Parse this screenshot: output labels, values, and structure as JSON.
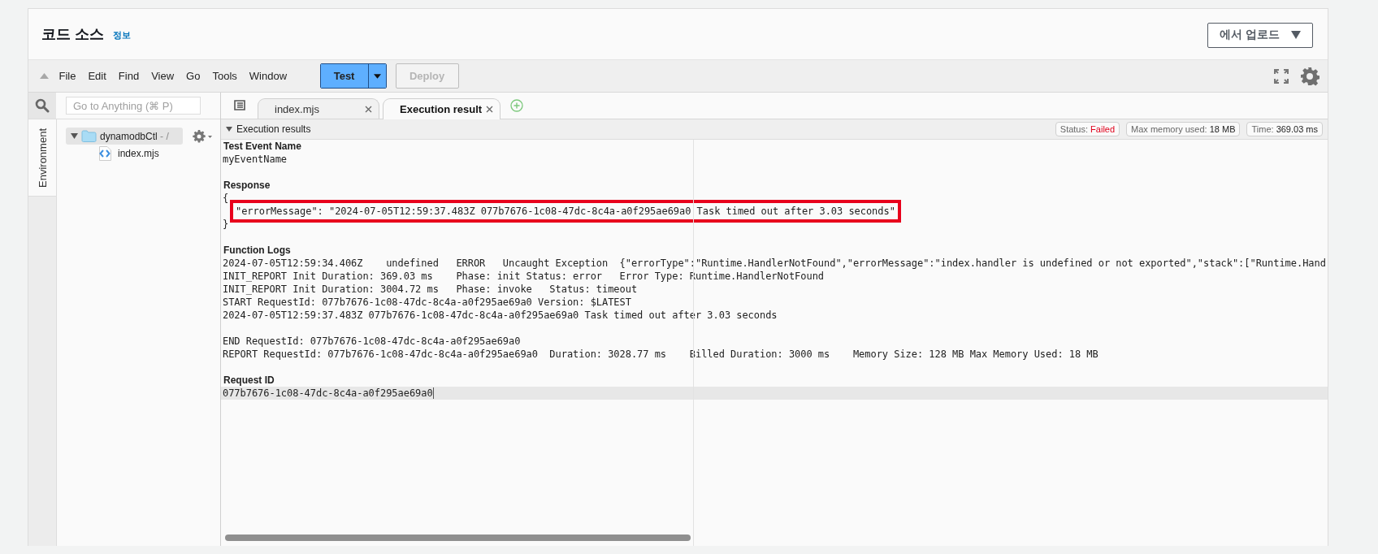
{
  "header": {
    "title": "코드 소스",
    "info_link": "정보",
    "upload_button": "에서 업로드"
  },
  "menu": [
    "File",
    "Edit",
    "Find",
    "View",
    "Go",
    "Tools",
    "Window"
  ],
  "toolbar": {
    "test_button": "Test",
    "deploy": {
      "label": "Deploy",
      "disabled": true
    }
  },
  "search": {
    "placeholder": "Go to Anything (⌘ P)"
  },
  "side_tab": "Environment",
  "file_tree": [
    {
      "name": "dynamodbCtl",
      "suffix": "- /",
      "expanded": true,
      "selected": true,
      "children": [
        {
          "name": "index.mjs",
          "selected": false
        }
      ]
    }
  ],
  "tabs": [
    {
      "label": "index.mjs",
      "selected": false
    },
    {
      "label": "Execution result",
      "selected": true
    }
  ],
  "results": {
    "title": "Execution results",
    "expanded": true,
    "badges": [
      {
        "label": "Status:",
        "value": "Failed",
        "kind": "error"
      },
      {
        "label": "Max memory used:",
        "value": "18 MB",
        "kind": "plain"
      },
      {
        "label": "Time:",
        "value": "369.03 ms",
        "kind": "plain"
      }
    ],
    "sections": [
      {
        "heading": "Test Event Name",
        "blocks": [
          [
            {
              "text": "myEventName"
            }
          ]
        ]
      },
      {
        "heading": "Response",
        "blocks": [
          [
            {
              "text": "{"
            },
            {
              "text": "\"errorMessage\": \"2024-07-05T12:59:37.483Z 077b7676-1c08-47dc-8c4a-a0f295ae69a0 Task timed out after 3.03 seconds\"",
              "indented": true,
              "highlighted": true
            },
            {
              "text": "}"
            }
          ]
        ]
      },
      {
        "heading": "Function Logs",
        "blocks": [
          [
            {
              "text": "2024-07-05T12:59:34.406Z    undefined   ERROR   Uncaught Exception  {\"errorType\":\"Runtime.HandlerNotFound\",\"errorMessage\":\"index.handler is undefined or not exported\",\"stack\":[\"Runtime.Hand"
            },
            {
              "text": "INIT_REPORT Init Duration: 369.03 ms    Phase: init Status: error   Error Type: Runtime.HandlerNotFound"
            },
            {
              "text": "INIT_REPORT Init Duration: 3004.72 ms   Phase: invoke   Status: timeout"
            },
            {
              "text": "START RequestId: 077b7676-1c08-47dc-8c4a-a0f295ae69a0 Version: $LATEST"
            },
            {
              "text": "2024-07-05T12:59:37.483Z 077b7676-1c08-47dc-8c4a-a0f295ae69a0 Task timed out after 3.03 seconds"
            }
          ],
          [
            {
              "text": "END RequestId: 077b7676-1c08-47dc-8c4a-a0f295ae69a0"
            },
            {
              "text": "REPORT RequestId: 077b7676-1c08-47dc-8c4a-a0f295ae69a0  Duration: 3028.77 ms    Billed Duration: 3000 ms    Memory Size: 128 MB Max Memory Used: 18 MB"
            }
          ]
        ]
      },
      {
        "heading": "Request ID",
        "blocks": [
          [
            {
              "text": "077b7676-1c08-47dc-8c4a-a0f295ae69a0",
              "current_line": true
            }
          ]
        ]
      }
    ]
  }
}
